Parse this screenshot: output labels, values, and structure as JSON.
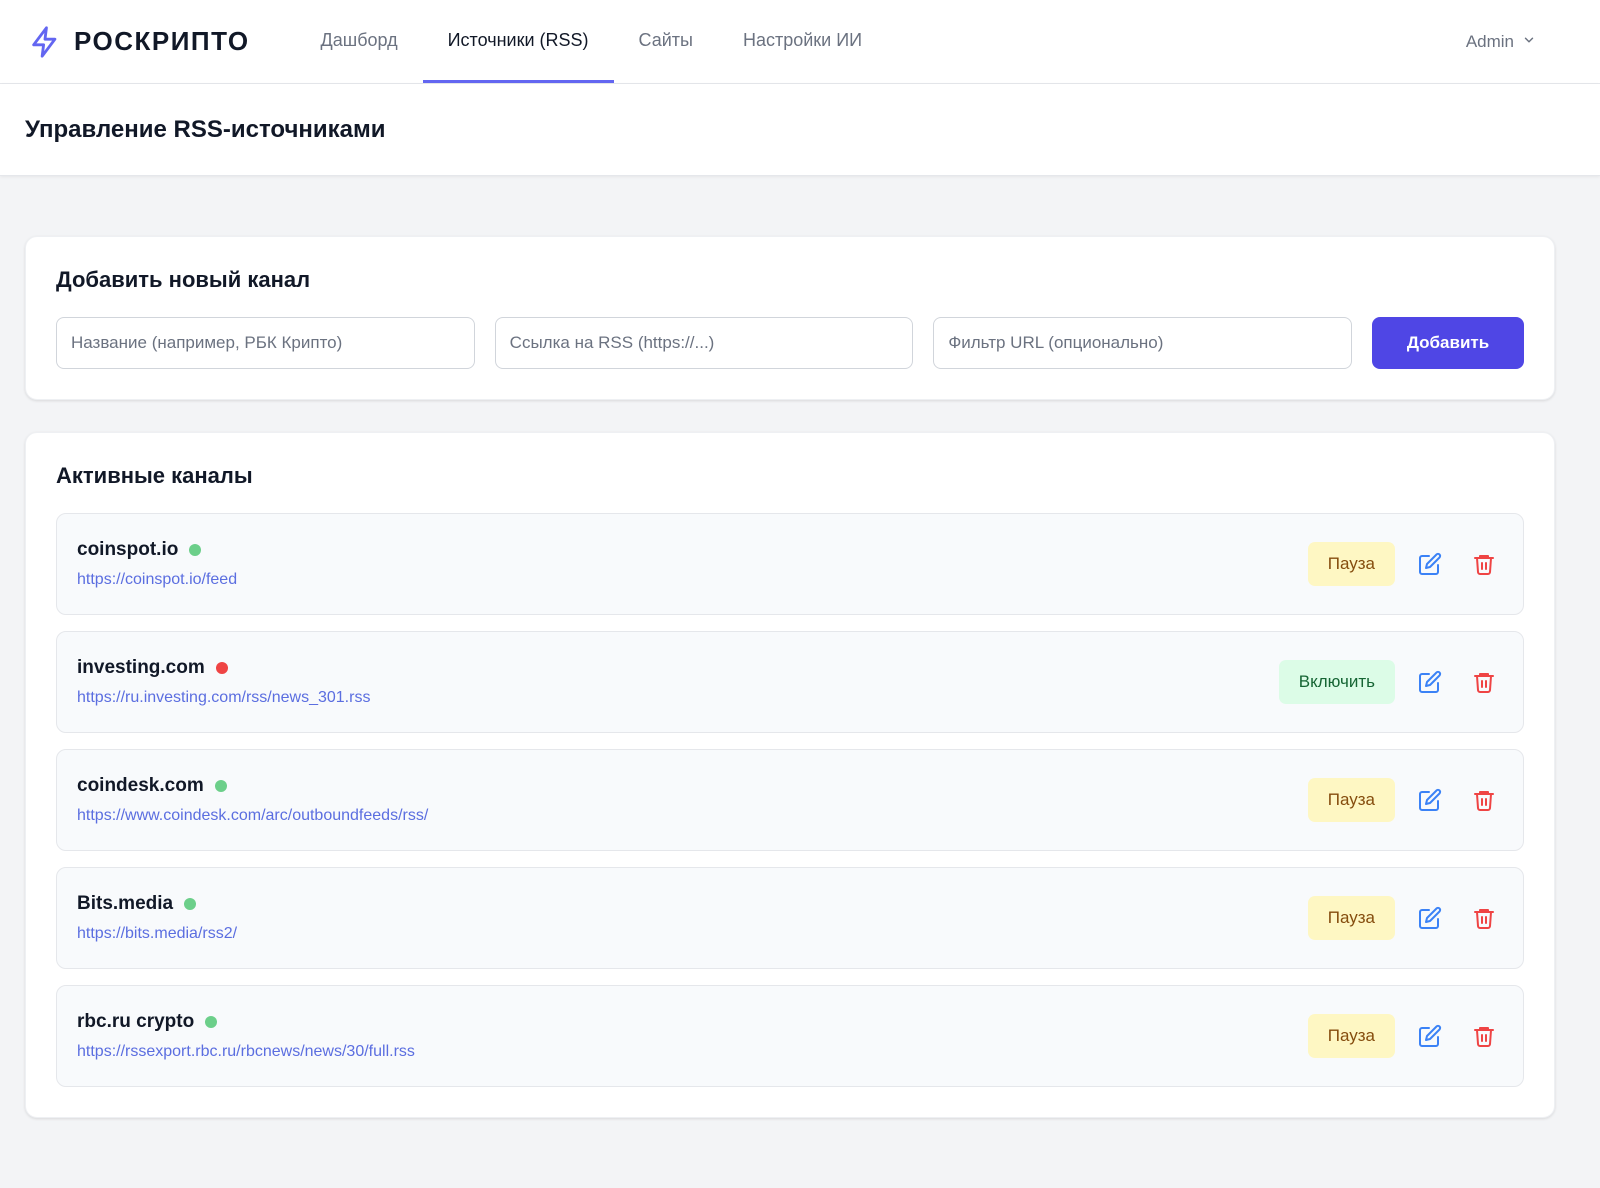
{
  "brand": {
    "name": "РОСКРИПТО",
    "icon": "lightning-icon",
    "accent": "#6366f1"
  },
  "nav": {
    "items": [
      {
        "label": "Дашборд",
        "active": false
      },
      {
        "label": "Источники (RSS)",
        "active": true
      },
      {
        "label": "Сайты",
        "active": false
      },
      {
        "label": "Настройки ИИ",
        "active": false
      }
    ],
    "user": "Admin"
  },
  "page": {
    "title": "Управление RSS-источниками"
  },
  "add_form": {
    "title": "Добавить новый канал",
    "name_placeholder": "Название (например, РБК Крипто)",
    "url_placeholder": "Ссылка на RSS (https://...)",
    "filter_placeholder": "Фильтр URL (опционально)",
    "submit_label": "Добавить",
    "submit_color": "#4f46e5"
  },
  "feeds": {
    "title": "Активные каналы",
    "items": [
      {
        "name": "coinspot.io",
        "status": "active",
        "url": "https://coinspot.io/feed",
        "action": "Пауза"
      },
      {
        "name": "investing.com",
        "status": "error",
        "url": "https://ru.investing.com/rss/news_301.rss",
        "action": "Включить"
      },
      {
        "name": "coindesk.com",
        "status": "active",
        "url": "https://www.coindesk.com/arc/outboundfeeds/rss/",
        "action": "Пауза"
      },
      {
        "name": "Bits.media",
        "status": "active",
        "url": "https://bits.media/rss2/",
        "action": "Пауза"
      },
      {
        "name": "rbc.ru crypto",
        "status": "active",
        "url": "https://rssexport.rbc.ru/rbcnews/news/30/full.rss",
        "action": "Пауза"
      }
    ],
    "status_colors": {
      "active": "#6ccf8a",
      "error": "#ef4444"
    },
    "edit_icon": "edit-icon",
    "delete_icon": "trash-icon"
  }
}
